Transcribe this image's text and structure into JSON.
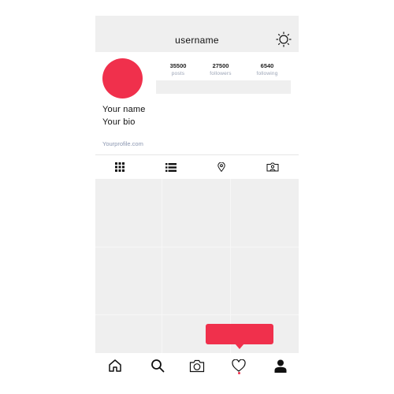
{
  "header": {
    "title": "username",
    "settings_icon": "sun-gear-icon"
  },
  "profile": {
    "avatar_color": "#f0304c",
    "stats": [
      {
        "value": "35500",
        "label": "posts"
      },
      {
        "value": "27500",
        "label": "followers"
      },
      {
        "value": "6540",
        "label": "following"
      }
    ],
    "name": "Your name",
    "bio": "Your bio",
    "link": "Yourprofile.com"
  },
  "tabs": [
    {
      "icon": "grid-view-icon"
    },
    {
      "icon": "list-view-icon"
    },
    {
      "icon": "location-pin-icon"
    },
    {
      "icon": "tagged-photo-icon"
    }
  ],
  "nav": [
    {
      "icon": "home-icon"
    },
    {
      "icon": "search-icon"
    },
    {
      "icon": "camera-icon"
    },
    {
      "icon": "heart-icon"
    },
    {
      "icon": "profile-icon"
    }
  ],
  "colors": {
    "accent": "#f0304c",
    "panel": "#efefef",
    "muted_text": "#9aa3b5"
  }
}
